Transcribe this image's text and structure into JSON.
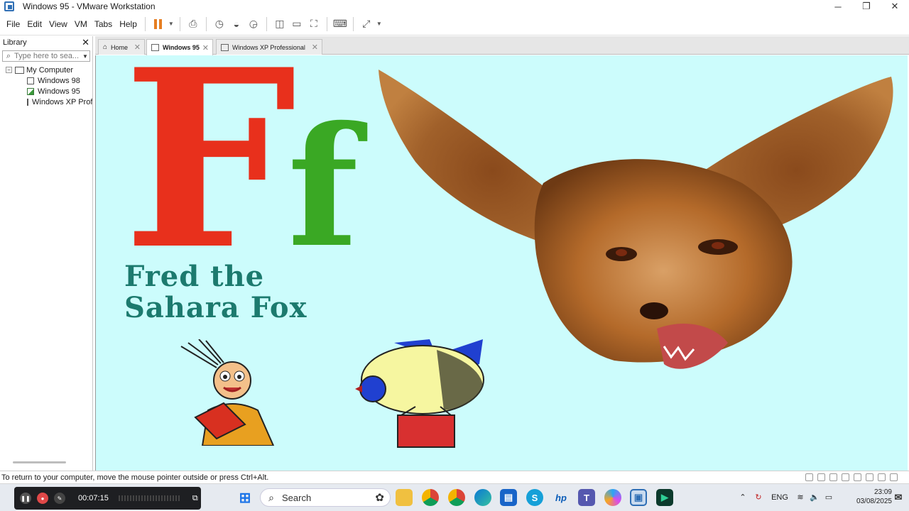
{
  "window": {
    "title": "Windows 95 - VMware Workstation"
  },
  "menu": {
    "file": "File",
    "edit": "Edit",
    "view": "View",
    "vm": "VM",
    "tabs": "Tabs",
    "help": "Help"
  },
  "library": {
    "title": "Library",
    "search_placeholder": "Type here to sea...",
    "tree": {
      "root": "My Computer",
      "items": [
        "Windows 98",
        "Windows 95",
        "Windows XP Prof"
      ]
    }
  },
  "tabs": [
    {
      "label": "Home"
    },
    {
      "label": "Windows 95"
    },
    {
      "label": "Windows XP Professional"
    }
  ],
  "guest": {
    "big_letter": "F",
    "small_letter": "f",
    "caption_line1": "Fred the",
    "caption_line2": "Sahara Fox"
  },
  "status": {
    "message": "To return to your computer, move the mouse pointer outside or press Ctrl+Alt."
  },
  "recorder": {
    "time": "00:07:15"
  },
  "taskbar": {
    "search_label": "Search",
    "language": "ENG",
    "time": "23:09",
    "date": "03/08/2025"
  }
}
